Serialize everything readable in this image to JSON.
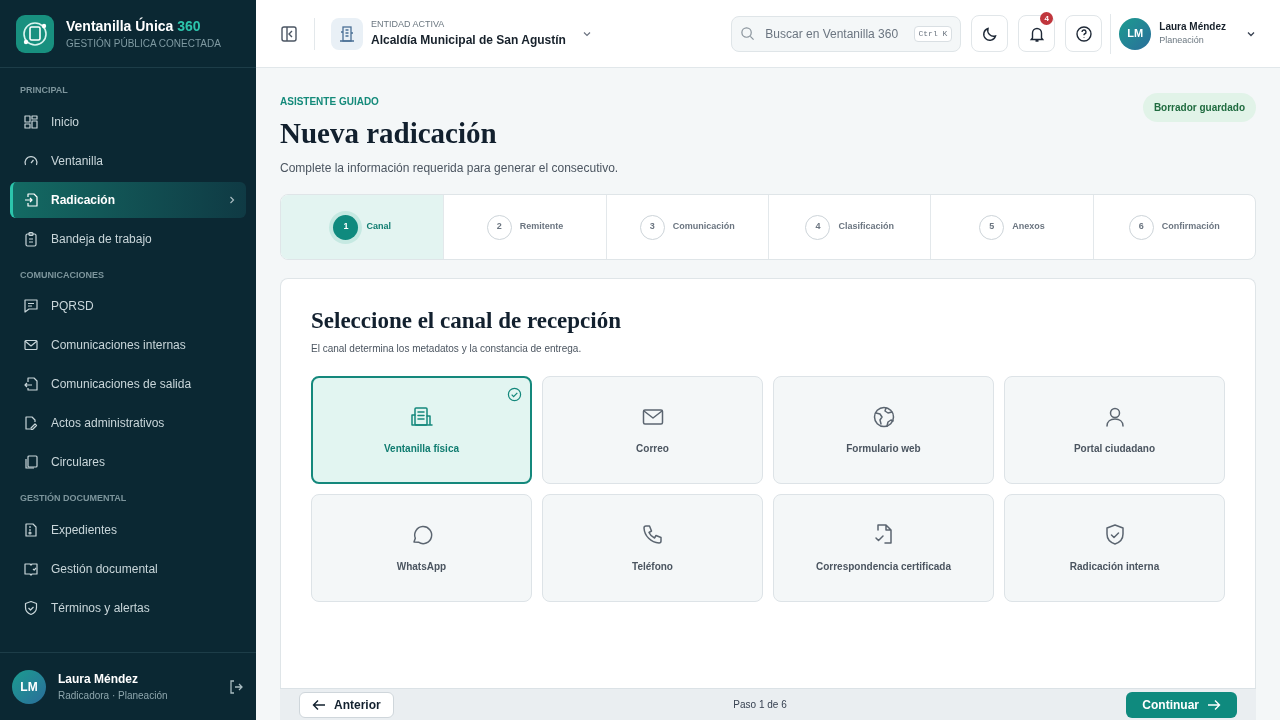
{
  "brand": {
    "name": "Ventanilla Única",
    "accent": "360",
    "tagline": "GESTIÓN PÚBLICA CONECTADA"
  },
  "sidebar": {
    "sections": [
      {
        "title": "PRINCIPAL",
        "items": [
          {
            "label": "Inicio",
            "selected": false
          },
          {
            "label": "Ventanilla",
            "selected": false
          },
          {
            "label": "Radicación",
            "selected": true
          },
          {
            "label": "Bandeja de trabajo",
            "selected": false
          }
        ]
      },
      {
        "title": "COMUNICACIONES",
        "items": [
          {
            "label": "PQRSD",
            "selected": false
          },
          {
            "label": "Comunicaciones internas",
            "selected": false
          },
          {
            "label": "Comunicaciones de salida",
            "selected": false
          },
          {
            "label": "Actos administrativos",
            "selected": false
          },
          {
            "label": "Circulares",
            "selected": false
          }
        ]
      },
      {
        "title": "GESTIÓN DOCUMENTAL",
        "items": [
          {
            "label": "Expedientes",
            "selected": false
          },
          {
            "label": "Gestión documental",
            "selected": false
          },
          {
            "label": "Términos y alertas",
            "selected": false
          }
        ]
      }
    ],
    "user": {
      "initials": "LM",
      "name": "Laura Méndez",
      "role": "Radicadora · Planeación"
    }
  },
  "header": {
    "entity_label": "ENTIDAD ACTIVA",
    "entity": "Alcaldía Municipal de San Agustín",
    "search": {
      "placeholder": "Buscar en Ventanilla 360",
      "shortcut": "Ctrl K"
    },
    "notifications": "4",
    "user": {
      "initials": "LM",
      "name": "Laura Méndez",
      "area": "Planeación"
    }
  },
  "page": {
    "eyebrow": "ASISTENTE GUIADO",
    "title": "Nueva radicación",
    "subtitle": "Complete la información requerida para generar el consecutivo.",
    "status": "Borrador guardado"
  },
  "steps": [
    {
      "number": "1",
      "label": "Canal",
      "selected": true
    },
    {
      "number": "2",
      "label": "Remitente",
      "selected": false
    },
    {
      "number": "3",
      "label": "Comunicación",
      "selected": false
    },
    {
      "number": "4",
      "label": "Clasificación",
      "selected": false
    },
    {
      "number": "5",
      "label": "Anexos",
      "selected": false
    },
    {
      "number": "6",
      "label": "Confirmación",
      "selected": false
    }
  ],
  "channel_panel": {
    "title": "Seleccione el canal de recepción",
    "subtitle": "El canal determina los metadatos y la constancia de entrega.",
    "channels": [
      {
        "label": "Ventanilla física",
        "selected": true
      },
      {
        "label": "Correo",
        "selected": false
      },
      {
        "label": "Formulario web",
        "selected": false
      },
      {
        "label": "Portal ciudadano",
        "selected": false
      },
      {
        "label": "WhatsApp",
        "selected": false
      },
      {
        "label": "Teléfono",
        "selected": false
      },
      {
        "label": "Correspondencia certificada",
        "selected": false
      },
      {
        "label": "Radicación interna",
        "selected": false
      }
    ]
  },
  "footer": {
    "back": "Anterior",
    "progress": "Paso 1 de 6",
    "next": "Continuar"
  }
}
